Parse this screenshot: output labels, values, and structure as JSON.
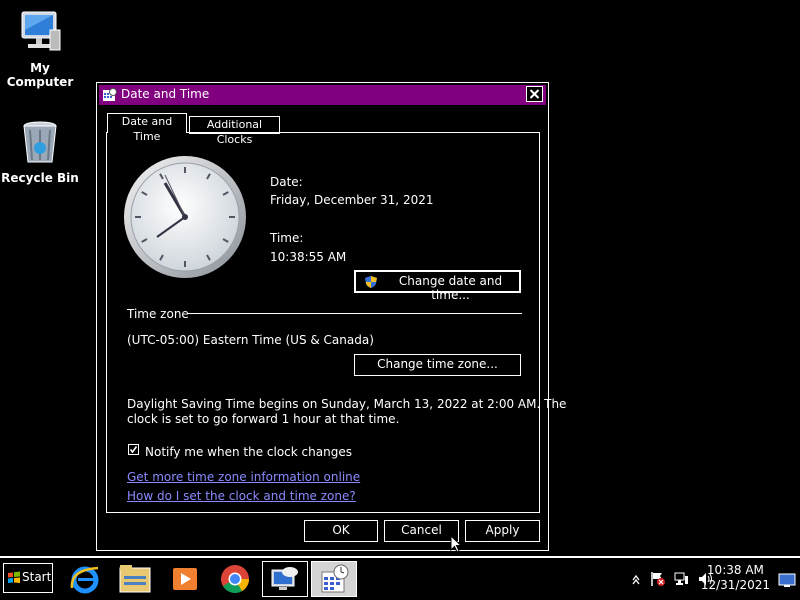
{
  "desktop": {
    "icons": [
      {
        "label": "My Computer",
        "icon": "computer-icon"
      },
      {
        "label": "Recycle Bin",
        "icon": "recycle-bin-icon"
      }
    ]
  },
  "window": {
    "title": "Date and Time",
    "title_icon": "date-time-icon",
    "tabs": [
      {
        "label": "Date and Time",
        "active": true
      },
      {
        "label": "Additional Clocks",
        "active": false
      }
    ],
    "date_label": "Date:",
    "date_value": "Friday, December 31, 2021",
    "time_label": "Time:",
    "time_value": "10:38:55 AM",
    "change_datetime_button": "Change date and time...",
    "timezone_heading": "Time zone",
    "timezone_value": "(UTC-05:00) Eastern Time (US & Canada)",
    "change_timezone_button": "Change time zone...",
    "dst_line1": "Daylight Saving Time begins on Sunday, March 13, 2022 at 2:00 AM. The",
    "dst_line2": "clock is set to go forward 1 hour at that time.",
    "notify_label": "Notify me when the clock changes",
    "notify_checked": true,
    "link_more_info": "Get more time zone information online",
    "link_how_to": "How do I set the clock and time zone?",
    "ok_button": "OK",
    "cancel_button": "Cancel",
    "apply_button": "Apply"
  },
  "taskbar": {
    "start_label": "Start",
    "pinned": [
      "internet-explorer-icon",
      "file-explorer-icon",
      "media-player-icon",
      "chrome-icon",
      "remote-desktop-icon",
      "date-time-icon"
    ],
    "tray_time": "10:38 AM",
    "tray_date": "12/31/2021"
  },
  "colors": {
    "titlebar": "#800080",
    "link": "#8a8aff",
    "background": "#000000"
  }
}
